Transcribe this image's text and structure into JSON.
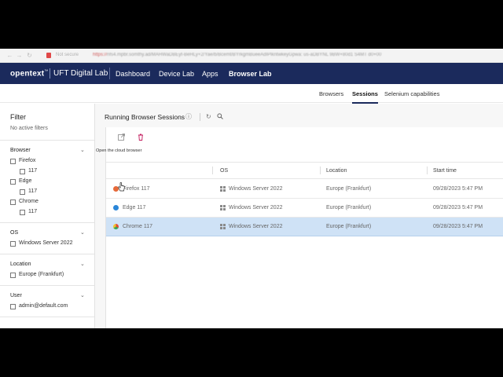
{
  "browser_chrome": {
    "nav_back": "←",
    "nav_forward": "→",
    "nav_reload": "↻",
    "security_label": "Not secure",
    "url_prefix": "https://",
    "url_rest": "nfs4.mpbr.somthy.ad/MAHWaDBEyt-BeHLy+2/Yae/b/Bcemt/BYrkgmBueeAdIPlkntwkeyGpwa: us-aDBYNL 9BW+80d1 S4MT d0+00"
  },
  "topnav": {
    "brand": "opentext",
    "brand_mark": "™",
    "product": "UFT Digital Lab",
    "links": [
      {
        "label": "Dashboard",
        "active": false
      },
      {
        "label": "Device Lab",
        "active": false
      },
      {
        "label": "Apps",
        "active": false
      },
      {
        "label": "Browser Lab",
        "active": true
      }
    ]
  },
  "subtabs": [
    {
      "label": "Browsers",
      "active": false
    },
    {
      "label": "Sessions",
      "active": true
    },
    {
      "label": "Selenium capabilities",
      "active": false
    }
  ],
  "sidebar": {
    "title": "Filter",
    "status": "No active filters",
    "sections": [
      {
        "title": "Browser",
        "items": [
          {
            "label": "Firefox",
            "level": 0,
            "checked": false
          },
          {
            "label": "117",
            "level": 1,
            "checked": false
          },
          {
            "label": "Edge",
            "level": 0,
            "checked": false
          },
          {
            "label": "117",
            "level": 1,
            "checked": false
          },
          {
            "label": "Chrome",
            "level": 0,
            "checked": false
          },
          {
            "label": "117",
            "level": 1,
            "checked": false
          }
        ]
      },
      {
        "title": "OS",
        "items": [
          {
            "label": "Windows Server 2022",
            "level": 0,
            "checked": false
          }
        ]
      },
      {
        "title": "Location",
        "items": [
          {
            "label": "Europe (Frankfurt)",
            "level": 0,
            "checked": false
          }
        ]
      },
      {
        "title": "User",
        "items": [
          {
            "label": "admin@default.com",
            "level": 0,
            "checked": false
          }
        ]
      }
    ]
  },
  "main": {
    "title": "Running Browser Sessions",
    "tooltip": "Open the cloud browser",
    "columns": [
      "OS",
      "Location",
      "Start time"
    ],
    "rows": [
      {
        "browser": "Firefox 117",
        "browser_icon": "firefox-icon",
        "icon_color": "#e66a3a",
        "os": "Windows Server 2022",
        "location": "Europe (Frankfurt)",
        "start_time": "09/28/2023 5:47 PM",
        "selected": false
      },
      {
        "browser": "Edge 117",
        "browser_icon": "edge-icon",
        "icon_color": "#2a86d8",
        "os": "Windows Server 2022",
        "location": "Europe (Frankfurt)",
        "start_time": "09/28/2023 5:47 PM",
        "selected": false
      },
      {
        "browser": "Chrome 117",
        "browser_icon": "chrome-icon",
        "icon_color": "#e0b020",
        "os": "Windows Server 2022",
        "location": "Europe (Frankfurt)",
        "start_time": "09/28/2023 5:47 PM",
        "selected": true
      }
    ]
  },
  "colors": {
    "navbar": "#1b2a5c",
    "selected_row": "#cfe2f6",
    "delete_icon": "#c2185b"
  }
}
